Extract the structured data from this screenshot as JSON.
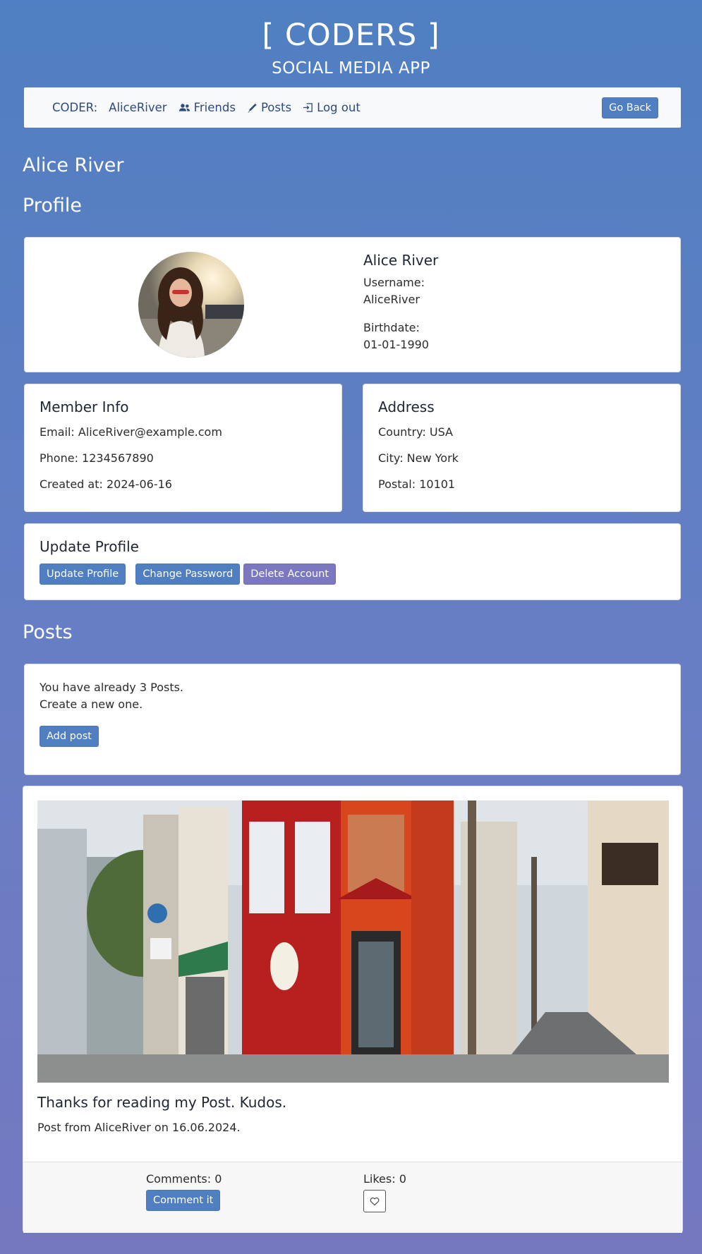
{
  "app": {
    "brand": "[ CODERS ]",
    "subtitle": "SOCIAL MEDIA APP"
  },
  "nav": {
    "coder_label": "CODER:",
    "username": "AliceRiver",
    "friends": "Friends",
    "posts": "Posts",
    "logout": "Log out",
    "go_back": "Go Back"
  },
  "page": {
    "user_name": "Alice River",
    "profile_heading": "Profile",
    "posts_heading": "Posts"
  },
  "profile": {
    "name": "Alice River",
    "username_label": "Username:",
    "username": "AliceRiver",
    "birthdate_label": "Birthdate:",
    "birthdate": "01-01-1990"
  },
  "member_info": {
    "title": "Member Info",
    "email": "Email: AliceRiver@example.com",
    "phone": "Phone: 1234567890",
    "created": "Created at: 2024-06-16"
  },
  "address": {
    "title": "Address",
    "country": "Country: USA",
    "city": "City: New York",
    "postal": "Postal: 10101"
  },
  "update": {
    "title": "Update Profile",
    "update_btn": "Update Profile",
    "password_btn": "Change Password",
    "delete_btn": "Delete Account"
  },
  "posts_summary": {
    "line1": "You have already 3 Posts.",
    "line2": "Create a new one.",
    "add_btn": "Add post"
  },
  "post": {
    "title": "Thanks for reading my Post. Kudos.",
    "meta": "Post from AliceRiver on 16.06.2024.",
    "comments": "Comments: 0",
    "comment_btn": "Comment it",
    "likes": "Likes: 0"
  },
  "colors": {
    "primary": "#4f7ec1",
    "danger_purple": "#7b78c1",
    "nav_text": "#2d4a7f"
  },
  "icons": {
    "friends": "users-icon",
    "posts": "pen-icon",
    "logout": "logout-icon",
    "like": "heart-icon"
  }
}
